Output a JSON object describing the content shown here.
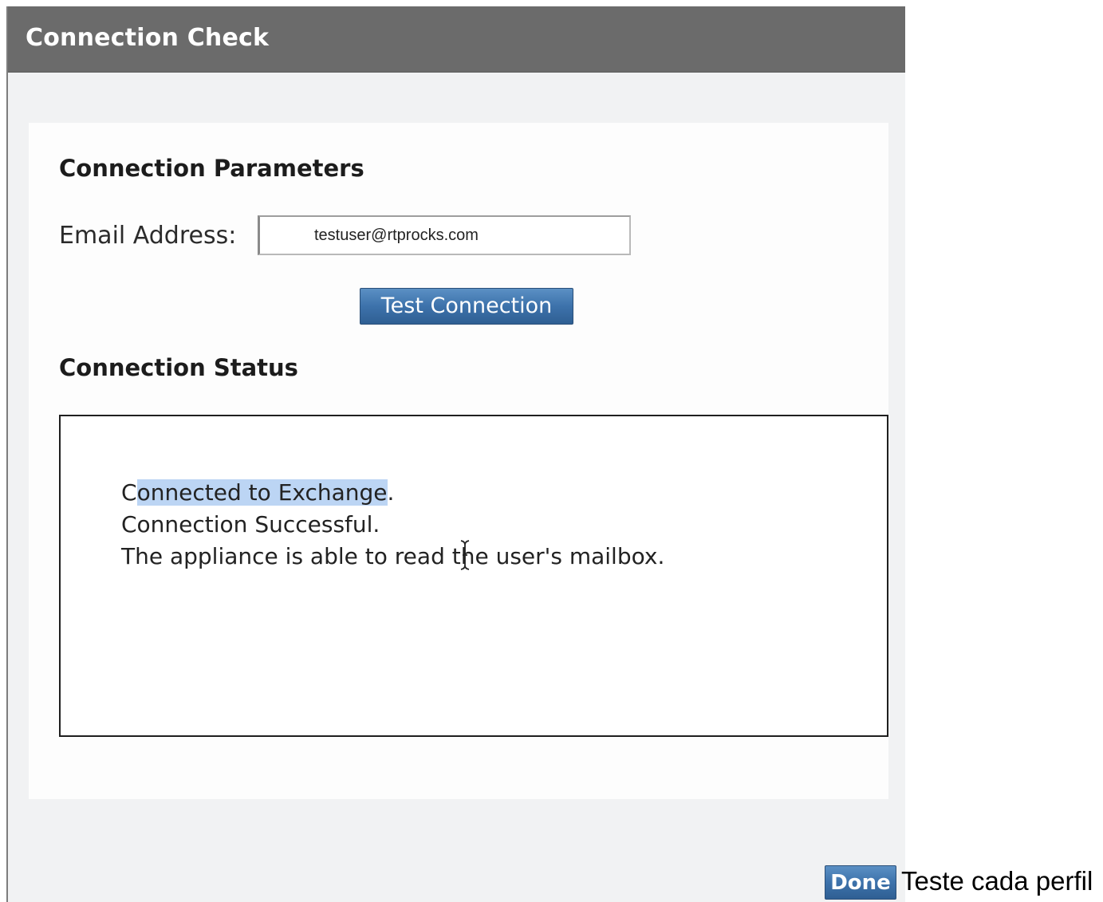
{
  "dialog": {
    "title": "Connection Check",
    "params_heading": "Connection Parameters",
    "email_label": "Email Address:",
    "email_value": "testuser@rtprocks.com",
    "test_button": "Test Connection",
    "status_heading": "Connection Status",
    "status": {
      "line1_first_char": "C",
      "line1_selected": "onnected to Exchange",
      "line1_end": ".",
      "line2": "Connection Successful.",
      "line3": "The appliance is able to read the user's mailbox."
    },
    "done_button": "Done"
  },
  "caption": "Teste cada perfil",
  "colors": {
    "titlebar": "#6b6b6b",
    "button": "#3d72ab",
    "selection": "#bcd5f4"
  }
}
